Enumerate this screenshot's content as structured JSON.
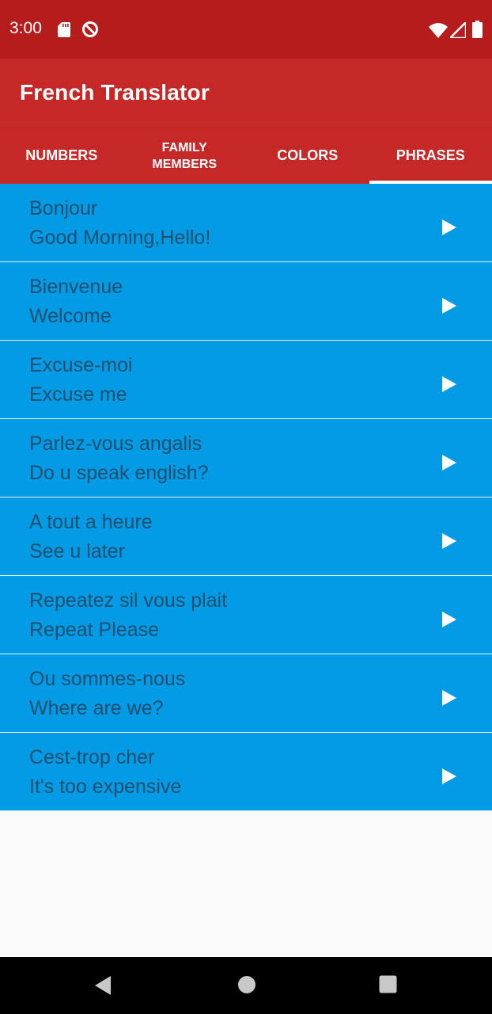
{
  "status_bar": {
    "time": "3:00",
    "icons": [
      "sd-card-icon",
      "data-saver-icon",
      "wifi-icon",
      "signal-icon",
      "battery-icon"
    ]
  },
  "app_bar": {
    "title": "French Translator"
  },
  "tabs": [
    {
      "label": "NUMBERS",
      "selected": false
    },
    {
      "label": "FAMILY MEMBERS",
      "selected": false
    },
    {
      "label": "COLORS",
      "selected": false
    },
    {
      "label": "PHRASES",
      "selected": true
    }
  ],
  "phrases": [
    {
      "french": "Bonjour",
      "english": "Good Morning,Hello!"
    },
    {
      "french": "Bienvenue",
      "english": "Welcome"
    },
    {
      "french": "Excuse-moi",
      "english": "Excuse me"
    },
    {
      "french": "Parlez-vous angalis",
      "english": "Do u speak english?"
    },
    {
      "french": "A tout a heure",
      "english": "See u later"
    },
    {
      "french": "Repeatez sil vous plait",
      "english": "Repeat Please"
    },
    {
      "french": "Ou sommes-nous",
      "english": "Where are we?"
    },
    {
      "french": "Cest-trop cher",
      "english": "It's too expensive"
    }
  ],
  "nav_bar": {
    "icons": [
      "back-icon",
      "home-icon",
      "recents-icon"
    ]
  },
  "colors": {
    "status_bar": "#b71c1c",
    "app_bar": "#c62828",
    "list_item": "#039be5",
    "list_text": "#1f4f6e",
    "background": "#fafafa"
  }
}
